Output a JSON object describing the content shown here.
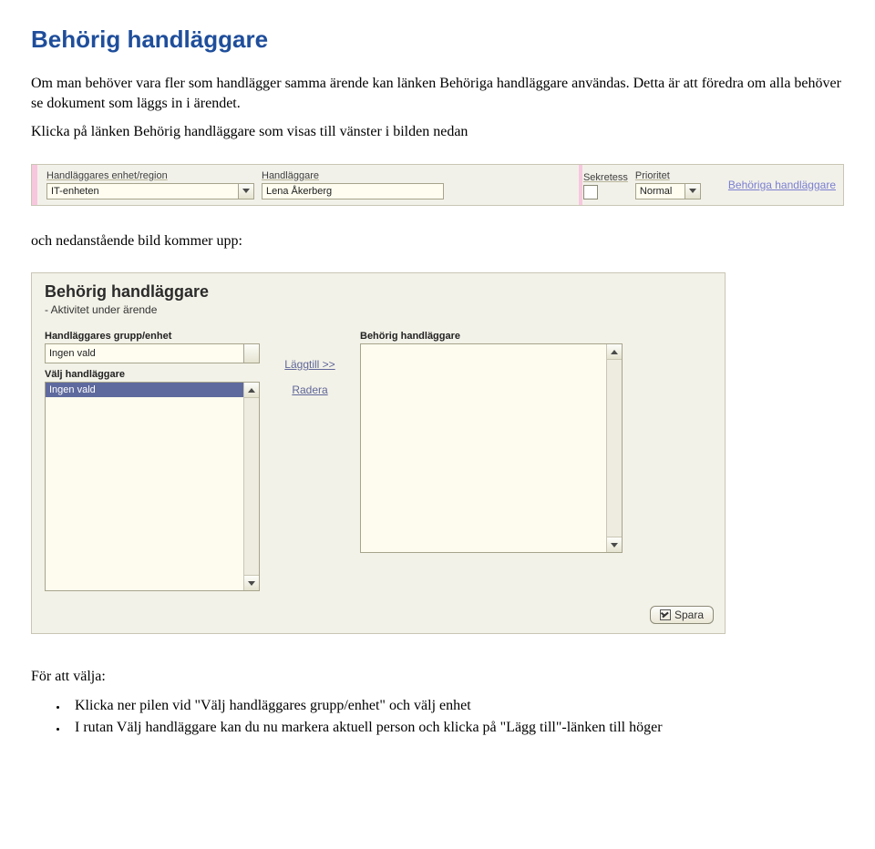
{
  "doc": {
    "title": "Behörig handläggare",
    "p1": "Om man behöver vara fler som handlägger samma ärende kan länken Behöriga handläggare användas. Detta är att föredra om alla behöver se dokument som läggs in i ärendet.",
    "p2": "Klicka på länken Behörig handläggare som visas till vänster i bilden nedan",
    "p3": "och nedanstående bild kommer upp:",
    "p4": "För att välja:",
    "bullets": [
      "Klicka ner pilen vid \"Välj handläggares grupp/enhet\" och välj enhet",
      "I rutan Välj handläggare kan du nu markera aktuell person och klicka på \"Lägg till\"-länken till höger"
    ]
  },
  "shot1": {
    "enhet_label": "Handläggares enhet/region",
    "enhet_value": "IT-enheten",
    "handl_label": "Handläggare",
    "handl_value": "Lena Åkerberg",
    "sekretess_label": "Sekretess",
    "prio_label": "Prioritet",
    "prio_value": "Normal",
    "link": "Behöriga handläggare"
  },
  "shot2": {
    "title": "Behörig handläggare",
    "subtitle": "- Aktivitet under ärende",
    "grupp_label": "Handläggares grupp/enhet",
    "grupp_value": "Ingen vald",
    "valj_label": "Välj handläggare",
    "valj_selected": "Ingen vald",
    "laggtill": "Läggtill >>",
    "radera": "Radera",
    "right_label": "Behörig handläggare",
    "spara": "Spara"
  }
}
